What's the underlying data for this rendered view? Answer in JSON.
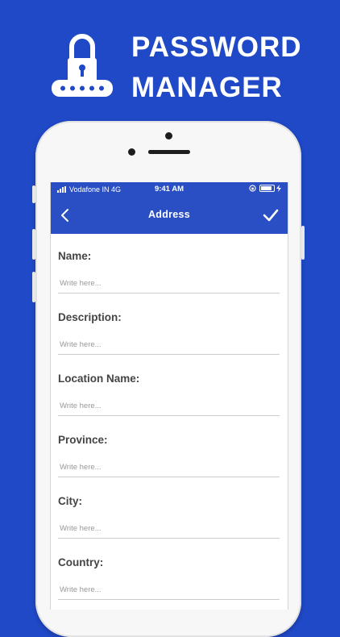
{
  "promo": {
    "title_line1": "PASSWORD",
    "title_line2": "MANAGER",
    "logo_icon": "lock-keyboard-icon"
  },
  "status_bar": {
    "carrier": "Vodafone IN 4G",
    "time": "9:41 AM"
  },
  "nav": {
    "title": "Address",
    "back_icon": "chevron-left-icon",
    "save_icon": "checkmark-icon"
  },
  "form": {
    "fields": [
      {
        "label": "Name:",
        "placeholder": "Write here...",
        "value": ""
      },
      {
        "label": "Description:",
        "placeholder": "Write here...",
        "value": ""
      },
      {
        "label": "Location Name:",
        "placeholder": "Write here...",
        "value": ""
      },
      {
        "label": "Province:",
        "placeholder": "Write here...",
        "value": ""
      },
      {
        "label": "City:",
        "placeholder": "Write here...",
        "value": ""
      },
      {
        "label": "Country:",
        "placeholder": "Write here...",
        "value": ""
      }
    ]
  },
  "colors": {
    "background": "#2049c8",
    "header_blue": "#2a4fc4",
    "label_text": "#444444"
  }
}
